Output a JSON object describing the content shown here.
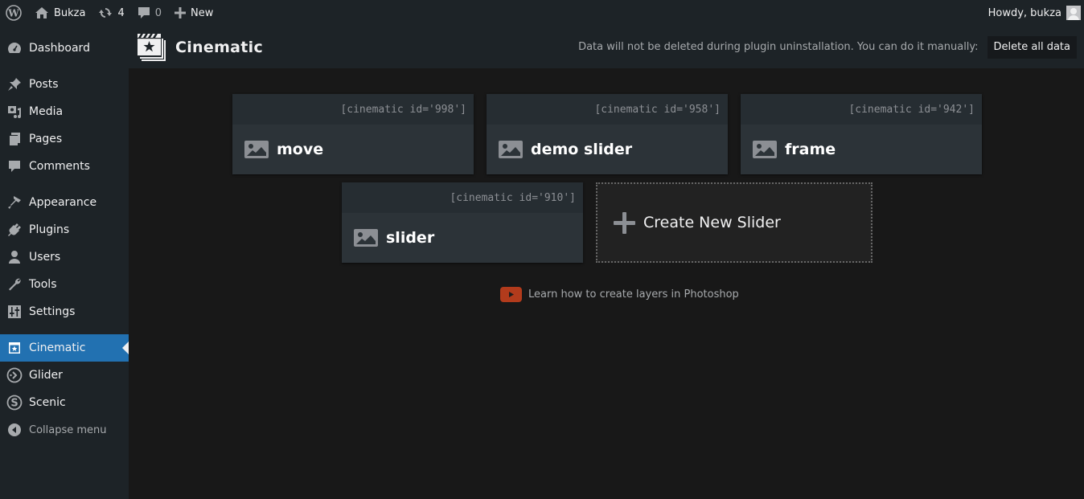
{
  "adminbar": {
    "site_name": "Bukza",
    "updates_count": "4",
    "comments_count": "0",
    "new_label": "New",
    "greeting": "Howdy, bukza"
  },
  "sidebar": {
    "items": [
      {
        "label": "Dashboard",
        "icon": "dashboard-icon"
      },
      {
        "label": "Posts",
        "icon": "pin-icon"
      },
      {
        "label": "Media",
        "icon": "media-icon"
      },
      {
        "label": "Pages",
        "icon": "pages-icon"
      },
      {
        "label": "Comments",
        "icon": "comment-icon"
      },
      {
        "label": "Appearance",
        "icon": "brush-icon"
      },
      {
        "label": "Plugins",
        "icon": "plug-icon"
      },
      {
        "label": "Users",
        "icon": "user-icon"
      },
      {
        "label": "Tools",
        "icon": "wrench-icon"
      },
      {
        "label": "Settings",
        "icon": "sliders-icon"
      },
      {
        "label": "Cinematic",
        "icon": "cinematic-icon",
        "current": true
      },
      {
        "label": "Glider",
        "icon": "glider-icon"
      },
      {
        "label": "Scenic",
        "icon": "scenic-icon"
      }
    ],
    "collapse_label": "Collapse menu"
  },
  "header": {
    "title": "Cinematic",
    "note": "Data will not be deleted during plugin uninstallation. You can do it manually:",
    "delete_label": "Delete all data"
  },
  "sliders": [
    {
      "shortcode": "[cinematic id='998']",
      "title": "move"
    },
    {
      "shortcode": "[cinematic id='958']",
      "title": "demo slider"
    },
    {
      "shortcode": "[cinematic id='942']",
      "title": "frame"
    },
    {
      "shortcode": "[cinematic id='910']",
      "title": "slider"
    }
  ],
  "create_label": "Create New Slider",
  "tutorial_link": "Learn how to create layers in Photoshop",
  "colors": {
    "accent": "#2271b1",
    "youtube": "#b23b1c"
  }
}
